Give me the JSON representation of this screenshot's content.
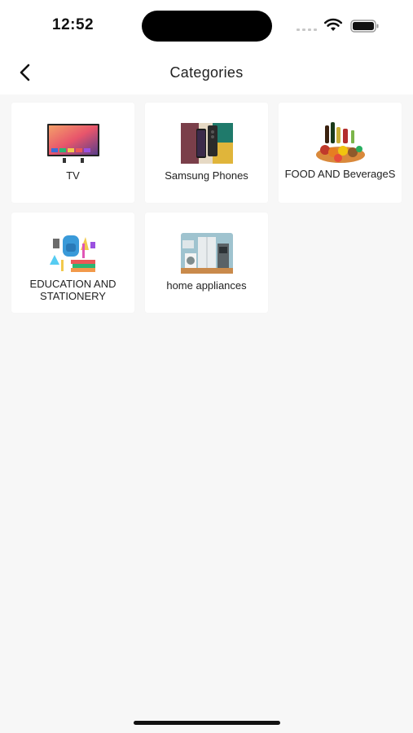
{
  "status_bar": {
    "time": "12:52",
    "icons": [
      "cellular-signal-icon",
      "wifi-icon",
      "battery-icon"
    ]
  },
  "header": {
    "title": "Categories",
    "back_icon": "chevron-left-icon"
  },
  "categories": [
    {
      "label": "TV",
      "image": "tv-image"
    },
    {
      "label": "Samsung Phones",
      "image": "phones-image"
    },
    {
      "label": "FOOD AND BeverageS",
      "image": "food-image"
    },
    {
      "label": "EDUCATION AND STATIONERY",
      "image": "stationery-image"
    },
    {
      "label": "home appliances",
      "image": "appliances-image"
    }
  ],
  "colors": {
    "background": "#f7f7f7",
    "card": "#ffffff",
    "text": "#222222"
  }
}
